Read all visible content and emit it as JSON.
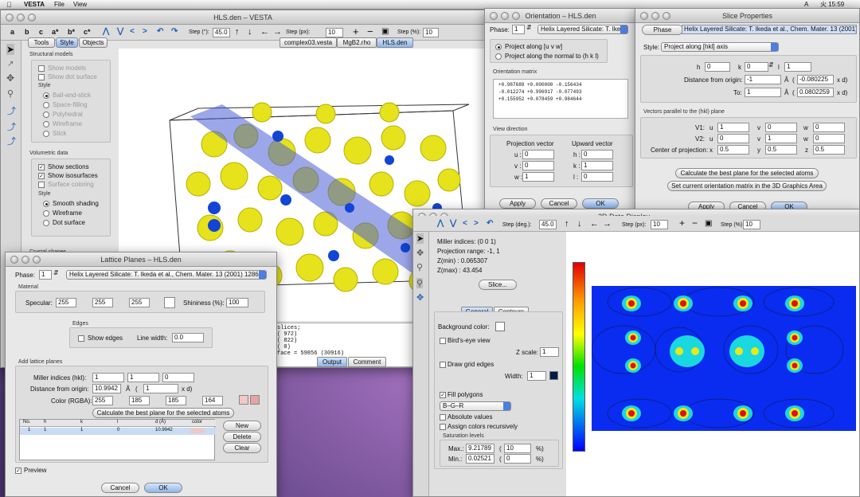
{
  "menubar": {
    "app": "VESTA",
    "items": [
      "File",
      "View"
    ],
    "clock": "火 15:59",
    "lang": "A"
  },
  "main": {
    "title": "HLS.den – VESTA",
    "tools": [
      "a",
      "b",
      "c",
      "a*",
      "b*",
      "c*"
    ],
    "step_label": "Step (°):",
    "step_val": "45.0",
    "steppx_label": "Step (px):",
    "steppx_val": "10",
    "scale_label": "Step (%):",
    "scale_val": "10",
    "panel_tabs": [
      "Tools",
      "Style",
      "Objects"
    ],
    "file_tabs": [
      "complex03.vesta",
      "MgB2.rho",
      "HLS.den"
    ],
    "structural_models": "Structural models",
    "show_models": "Show models",
    "show_dot": "Show dot surface",
    "style": "Style",
    "styles": [
      "Ball-and-stick",
      "Space-filling",
      "Polyhedral",
      "Wireframe",
      "Stick"
    ],
    "volumetric": "Volumetric data",
    "show_sections": "Show sections",
    "show_iso": "Show isosurfaces",
    "surface_col": "Surface coloring",
    "vstyles": [
      "Smooth shading",
      "Wireframe",
      "Dot surface"
    ],
    "crystal_shapes": "Crystal shapes",
    "output_lines": [
      "slices;",
      "(      972)",
      "(      822)",
      "(        0)",
      "face = 59856 (30916)"
    ],
    "out_tabs": [
      "Output",
      "Comment"
    ]
  },
  "orient": {
    "title": "Orientation – HLS.den",
    "phase": "Phase:",
    "phase_val": "1",
    "sel": "Helix Layered Silicate: T. Ikeda",
    "r1": "Project along [u v w]",
    "r2": "Project along the normal to (h k l)",
    "matrix_title": "Orientation matrix",
    "matrix": [
      "+0.987688  +0.000000  -0.156434",
      "-0.012274  +0.996917  -0.077493",
      "+0.155952  +0.078459  +0.984644"
    ],
    "viewdir": "View direction",
    "proj": "Projection vector",
    "up": "Upward vector",
    "u": "0",
    "v": "0",
    "w": "1",
    "h": "0",
    "k": "1",
    "l": "0",
    "apply": "Apply",
    "cancel": "Cancel",
    "ok": "OK"
  },
  "slice": {
    "title": "Slice Properties",
    "phase": "Phase",
    "sel_val": "Helix Layered Silicate: T. Ikeda et al., Chem. Mater. 13 (2001)",
    "style": "Style:",
    "style_val": "Project along [hkl] axis",
    "h": "0",
    "k": "0",
    "l": "1",
    "dist_label": "Distance from origin:",
    "dist": "-1",
    "dist_d": "-0.080225",
    "to_label": "To:",
    "to": "1",
    "to_d": "0.0802259",
    "unit": "Å",
    "xd": "x d)",
    "vec_title": "Vectors parallel to the (hkl) plane",
    "v1": [
      "1",
      "0",
      "0"
    ],
    "v2": [
      "0",
      "1",
      "0"
    ],
    "center": [
      "0.5",
      "0.5",
      "0.5"
    ],
    "center_label": "Center of projection:",
    "calc": "Calculate the best plane for the selected atoms",
    "setcur": "Set current orientation matrix in the 3D Graphics Area",
    "apply": "Apply",
    "cancel": "Cancel",
    "ok": "OK"
  },
  "lattice": {
    "title": "Lattice Planes – HLS.den",
    "phase": "Phase:",
    "phase_val": "1",
    "sel": "Helix Layered Silicate: T. Ikeda et al., Chem. Mater. 13 (2001) 1286",
    "material": "Material",
    "specular": "Specular:",
    "spec": [
      "255",
      "255",
      "255"
    ],
    "shininess": "Shininess (%):",
    "shin": "100",
    "edges": "Edges",
    "show_edges": "Show edges",
    "line_width": "Line width:",
    "lw": "0.0",
    "add": "Add lattice planes",
    "miller": "Miller indices (hkl):",
    "hkl": [
      "1",
      "1",
      "0"
    ],
    "dist": "Distance from origin:",
    "dist_val": "10.9942",
    "dist_xd": "1",
    "color": "Color (RGBA):",
    "rgba": [
      "255",
      "185",
      "185",
      "164"
    ],
    "calc": "Calculate the best plane for the selected atoms",
    "cols": [
      "No.",
      "h",
      "k",
      "l",
      "d (Å)",
      "color"
    ],
    "row": [
      "1",
      "1",
      "1",
      "0",
      "10.9942"
    ],
    "new": "New",
    "delete": "Delete",
    "clear": "Clear",
    "preview": "Preview",
    "cancel": "Cancel",
    "ok": "OK"
  },
  "d2": {
    "title": "2D Data Display",
    "step_label": "Step (deg.):",
    "step": "45.0",
    "steppx": "Step (px):",
    "steppx_val": "10",
    "scale": "Step (%):",
    "scale_val": "10",
    "info": [
      "Miller indices: (0 0 1)",
      "Projection range: -1, 1",
      "Z(min) : 0.065307",
      "Z(max) : 43.454"
    ],
    "slice_btn": "Slice...",
    "tabs": [
      "General",
      "Contours"
    ],
    "bg": "Background color:",
    "birds": "Bird's-eye view",
    "zscale": "Z scale:",
    "zval": "1",
    "grid": "Draw grid edges",
    "width": "Width:",
    "wval": "1",
    "fill": "Fill polygons",
    "cmap": "B–G–R",
    "absv": "Absolute values",
    "assign": "Assign colors recursively",
    "sat": "Saturation levels",
    "max": "Max.:",
    "maxv": "9.21789",
    "maxp": "10",
    "min": "Min.:",
    "minv": "0.02521",
    "minp": "0",
    "pct": "%)"
  }
}
